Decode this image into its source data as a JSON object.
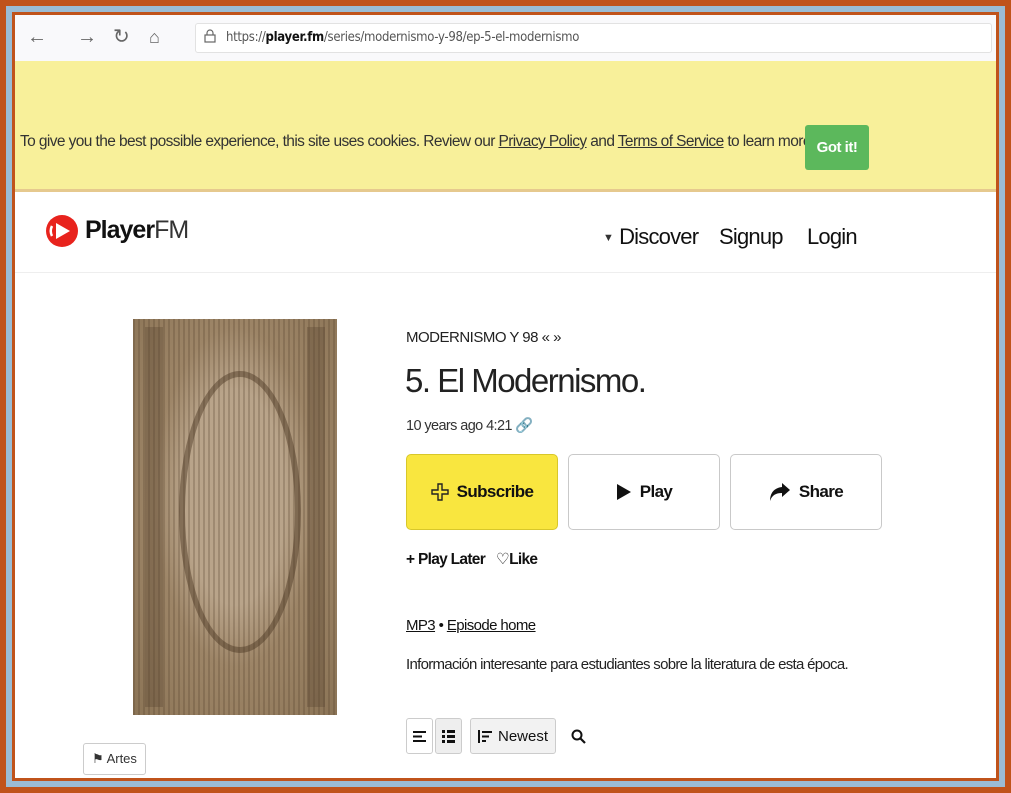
{
  "browser": {
    "url_prefix": "https://",
    "url_domain": "player.fm",
    "url_path": "/series/modernismo-y-98/ep-5-el-modernismo"
  },
  "cookie": {
    "text_before": "To give you the best possible experience, this site uses cookies. Review our ",
    "privacy_link": "Privacy Policy",
    "and": " and ",
    "terms_link": "Terms of Service",
    "text_after": " to learn more.",
    "button": "Got it!"
  },
  "header": {
    "logo_word": "Player",
    "logo_fm": "FM",
    "discover": "Discover",
    "signup": "Signup",
    "login": "Login"
  },
  "episode": {
    "series": "MODERNISMO Y 98",
    "series_nav": "« »",
    "title": "5. El Modernismo.",
    "meta": "10 years ago 4:21",
    "subscribe": "Subscribe",
    "play": "Play",
    "share": "Share",
    "play_later_prefix": "+ ",
    "play_later": "Play Later",
    "like": "Like",
    "format": "MP3",
    "episode_home": "Episode home",
    "description": "Información interesante para estudiantes sobre la literatura de esta época.",
    "sort_label": "Newest",
    "tag": "Artes"
  },
  "colors": {
    "frame": "#c0531b",
    "cookie_bg": "#f8f09a",
    "got_it": "#5cb85c",
    "subscribe": "#f9e63f",
    "logo_red": "#e8231d"
  }
}
